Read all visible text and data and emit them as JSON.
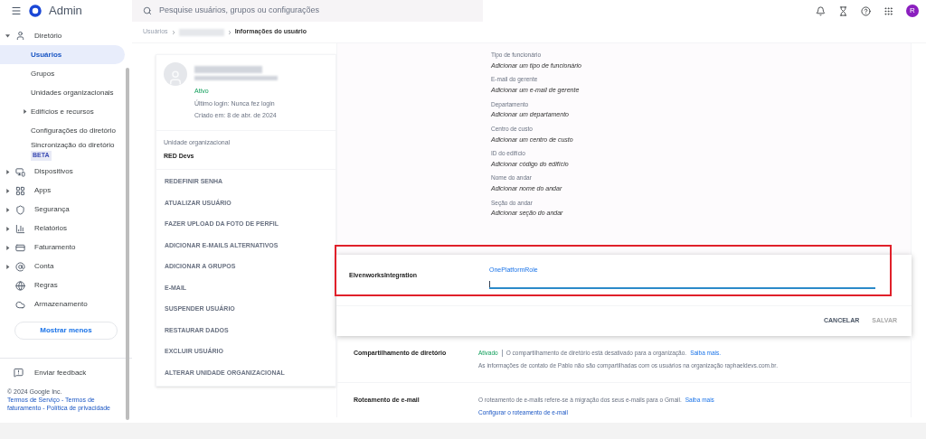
{
  "header": {
    "app_name": "Admin",
    "search": {
      "placeholder": "Pesquise usuários, grupos ou configurações"
    },
    "avatar": "R"
  },
  "sidebar": {
    "items": [
      {
        "kind": "section",
        "label": "Diretório",
        "expanded": true,
        "children": [
          {
            "label": "Usuários",
            "selected": true
          },
          {
            "label": "Grupos",
            "selected": false
          },
          {
            "label": "Unidades organizacionais",
            "selected": false
          },
          {
            "label": "Edifícios e recursos",
            "selected": false,
            "expanded": false
          },
          {
            "label": "Configurações do diretório",
            "selected": false
          },
          {
            "label": "Sincronização do diretório",
            "selected": false,
            "badge": "BETA"
          }
        ]
      },
      {
        "kind": "section",
        "label": "Dispositivos",
        "expanded": false
      },
      {
        "kind": "section",
        "label": "Apps",
        "expanded": false
      },
      {
        "kind": "section",
        "label": "Segurança",
        "expanded": false
      },
      {
        "kind": "section",
        "label": "Relatórios",
        "expanded": false
      },
      {
        "kind": "section",
        "label": "Faturamento",
        "expanded": false
      },
      {
        "kind": "section",
        "label": "Conta",
        "expanded": false
      },
      {
        "kind": "link",
        "label": "Regras"
      },
      {
        "kind": "link",
        "label": "Armazenamento"
      }
    ],
    "show_less": "Mostrar menos",
    "feedback": "Enviar feedback",
    "copyright": "© 2024 Google Inc.",
    "footer_links": "Termos de Serviço - Termos de faturamento - Política de privacidade"
  },
  "breadcrumb": [
    "Usuários",
    "Informações do usuário"
  ],
  "user_card": {
    "status": "Ativo",
    "last_login": "Último login: Nunca fez login",
    "created": "Criado em: 8 de abr. de 2024",
    "org_unit_label": "Unidade organizacional",
    "org_unit": "RED Devs",
    "actions": [
      "REDEFINIR SENHA",
      "ATUALIZAR USUÁRIO",
      "FAZER UPLOAD DA FOTO DE PERFIL",
      "ADICIONAR E-MAILS ALTERNATIVOS",
      "ADICIONAR A GRUPOS",
      "E-MAIL",
      "SUSPENDER USUÁRIO",
      "RESTAURAR DADOS",
      "EXCLUIR USUÁRIO",
      "ALTERAR UNIDADE ORGANIZACIONAL"
    ]
  },
  "fields": [
    {
      "label": "Tipo de funcionário",
      "value": "Adicionar um tipo de funcionário"
    },
    {
      "label": "E-mail do gerente",
      "value": "Adicionar um e-mail de gerente"
    },
    {
      "label": "Departamento",
      "value": "Adicionar um departamento"
    },
    {
      "label": "Centro de custo",
      "value": "Adicionar um centro de custo"
    },
    {
      "label": "ID do edifício",
      "value": "Adicionar código do edifício"
    },
    {
      "label": "Nome do andar",
      "value": "Adicionar nome do andar"
    },
    {
      "label": "Seção do andar",
      "value": "Adicionar seção do andar"
    }
  ],
  "edit_card": {
    "title": "ElvenworksIntegration",
    "field_label": "OnePlatformRole",
    "highlighted": true,
    "buttons": [
      {
        "label": "CANCELAR",
        "disabled": false
      },
      {
        "label": "SALVAR",
        "disabled": true
      }
    ]
  },
  "sharing": {
    "title": "Compartilhamento de diretório",
    "status": "Ativado",
    "note": "O compartilhamento de diretório está desativado para a organização.",
    "link": "Saiba mais.",
    "detail": "As informações de contato de Pablo não são compartilhadas com os usuários na organização raphaeldevs.com.br."
  },
  "routing": {
    "title": "Roteamento de e-mail",
    "note": "O roteamento de e-mails refere-se à migração dos seus e-mails para o Gmail.",
    "link": "Saiba mais",
    "action": "Configurar o roteamento de e-mail"
  }
}
